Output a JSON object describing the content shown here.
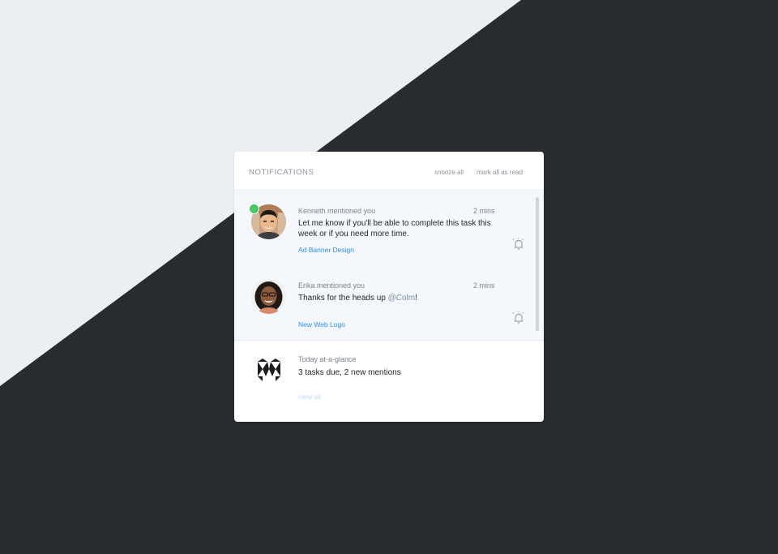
{
  "panel": {
    "title": "NOTIFICATIONS",
    "snooze_all": "snooze all",
    "mark_all_read": "mark all as read"
  },
  "notifications": [
    {
      "title": "Kenneth mentioned you",
      "time": "2 mins",
      "body": "Let me know if you'll be able to complete this task this week or if you need more time.",
      "link": "Ad Banner Design",
      "online": true,
      "icon": "snooze-bell-icon"
    },
    {
      "title": "Erika mentioned you",
      "time": "2 mins",
      "body_prefix": "Thanks for the heads up ",
      "mention": "@Colm",
      "body_suffix": "!",
      "link": "New Web Logo",
      "icon": "snooze-bell-icon"
    }
  ],
  "summary": {
    "title": "Today at-a-glance",
    "body": "3 tasks due, 2 new mentions",
    "link": "view all"
  },
  "colors": {
    "background_light": "#ebeff3",
    "background_dark": "#282c30",
    "accent_link": "#2d8fe6",
    "online_indicator": "#45c960",
    "unread_background": "#f4f8fc"
  }
}
